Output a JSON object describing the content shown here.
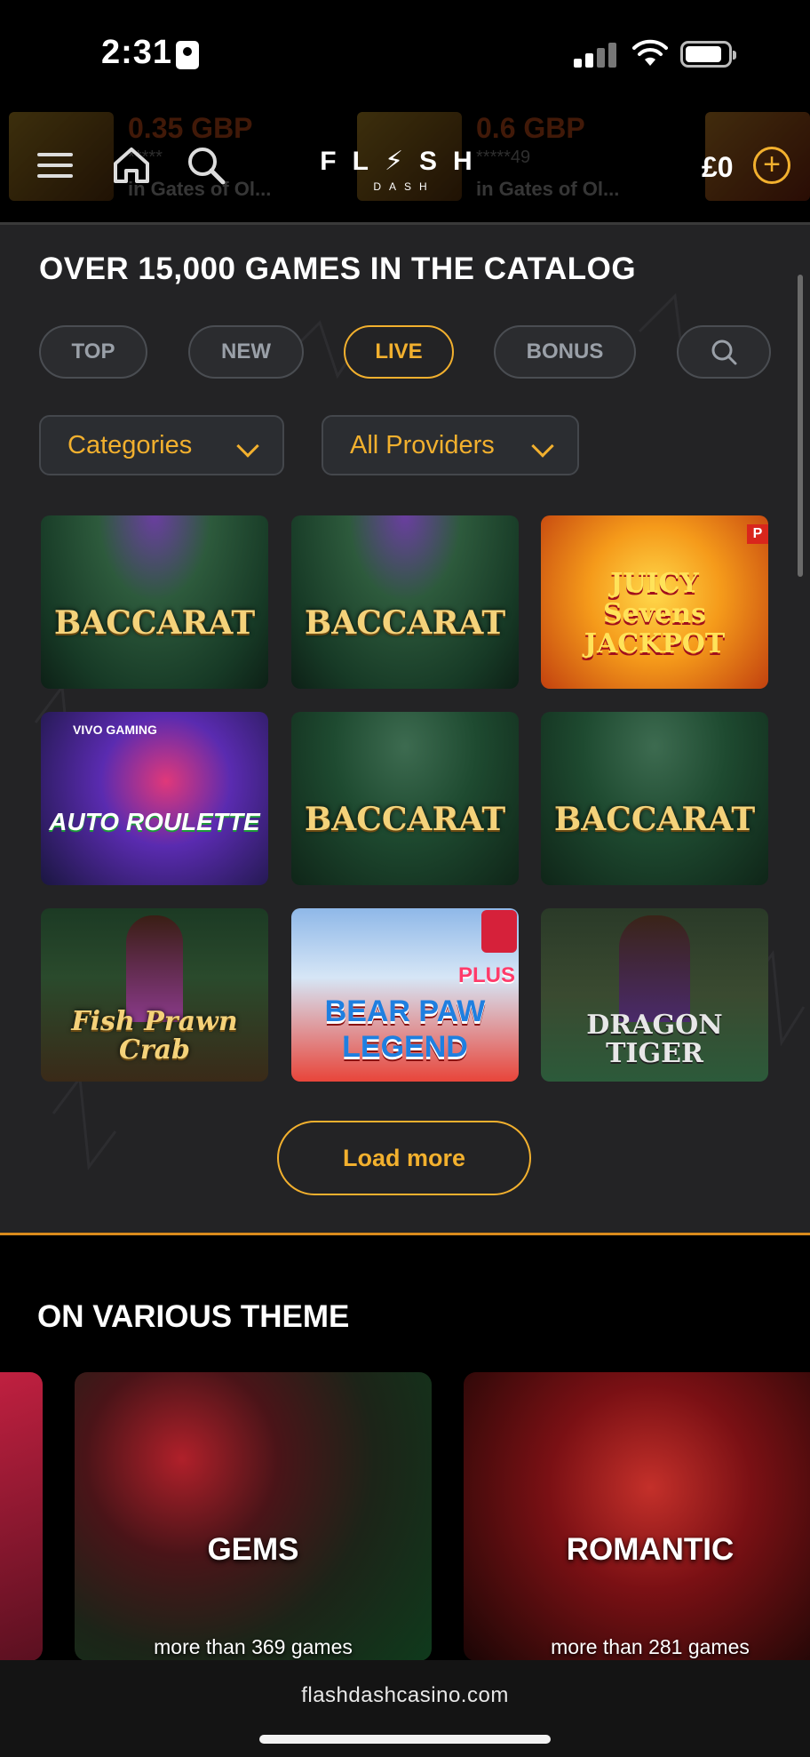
{
  "status_bar": {
    "time": "2:31"
  },
  "header": {
    "logo_word": "FL⚡SH",
    "logo_sub": "DASH",
    "balance": "£0",
    "add_symbol": "+",
    "ticker": [
      {
        "amount": "0.35 GBP",
        "user": "*****",
        "where": "in Gates of Ol..."
      },
      {
        "amount": "0.6 GBP",
        "user": "*****49",
        "where": "in Gates of Ol..."
      }
    ]
  },
  "catalog": {
    "title": "OVER 15,000 GAMES IN THE CATALOG",
    "tabs": [
      {
        "label": "TOP",
        "active": false
      },
      {
        "label": "NEW",
        "active": false
      },
      {
        "label": "LIVE",
        "active": true
      },
      {
        "label": "BONUS",
        "active": false
      }
    ],
    "categories_label": "Categories",
    "providers_label": "All Providers",
    "games": [
      {
        "name": "BACCARAT",
        "style": "baccarat"
      },
      {
        "name": "BACCARAT",
        "style": "baccarat"
      },
      {
        "name": "JUICY Sevens JACKPOT",
        "style": "juicy"
      },
      {
        "name": "AUTO ROULETTE",
        "style": "roulette",
        "brand": "VIVO GAMING"
      },
      {
        "name": "BACCARAT",
        "style": "baccarat"
      },
      {
        "name": "BACCARAT",
        "style": "baccarat"
      },
      {
        "name": "Fish Prawn Crab",
        "style": "fish"
      },
      {
        "name": "BEAR PAW LEGEND",
        "style": "bear",
        "badge": "PLUS"
      },
      {
        "name": "DRAGON TIGER",
        "style": "dragon"
      }
    ],
    "load_more": "Load more"
  },
  "themes": {
    "title": "ON VARIOUS THEME",
    "cards": [
      {
        "name": "GEMS",
        "count": "more than 369 games"
      },
      {
        "name": "ROMANTIC",
        "count": "more than 281 games"
      }
    ]
  },
  "browser": {
    "url": "flashdashcasino.com"
  },
  "colors": {
    "accent": "#f2b02e",
    "panel": "#232325",
    "divider": "#d98a1c"
  }
}
